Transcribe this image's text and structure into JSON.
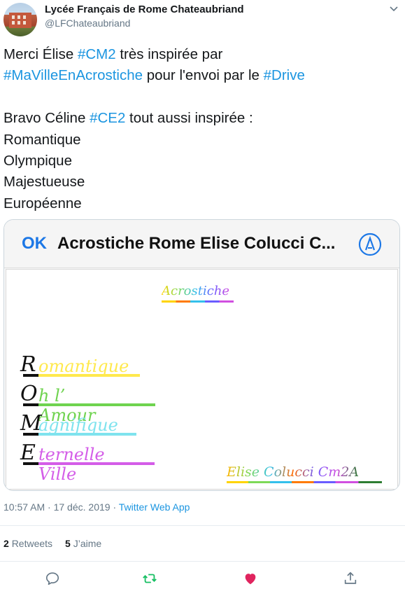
{
  "account": {
    "name": "Lycée Français de Rome Chateaubriand",
    "handle": "@LFChateaubriand"
  },
  "tweet": {
    "line1": [
      "Merci Élise ",
      "#CM2",
      " très inspirée par"
    ],
    "line2": [
      "#MaVilleEnAcrostiche",
      " pour l'envoi par le ",
      "#Drive"
    ],
    "line3": [
      "Bravo Céline ",
      "#CE2",
      " tout aussi inspirée :"
    ],
    "line4": "Romantique",
    "line5": "Olympique",
    "line6": "Majestueuse",
    "line7": "Européenne"
  },
  "card": {
    "ok_label": "OK",
    "title": "Acrostiche Rome Elise Colucci C...",
    "image": {
      "heading": "Acrostiche",
      "lines": [
        {
          "cap": "R",
          "rest": "omantique",
          "color": "#ffe94d"
        },
        {
          "cap": "O",
          "rest": "h l’ Amour",
          "color": "#6fd34f"
        },
        {
          "cap": "M",
          "rest": "agnifique",
          "color": "#7fe3ee"
        },
        {
          "cap": "E",
          "rest": "ternelle Ville",
          "color": "#d45de8"
        }
      ],
      "signature": "Elise Colucci Cm2A"
    }
  },
  "meta": {
    "time": "10:57 AM · 17 déc. 2019",
    "separator": " · ",
    "app": "Twitter Web App"
  },
  "stats": {
    "retweets_count": "2",
    "retweets_label": "Retweets",
    "likes_count": "5",
    "likes_label": "J’aime"
  },
  "colors": {
    "link": "#1b95e0",
    "retweet": "#17bf63",
    "like": "#e0245e",
    "muted": "#657786"
  },
  "icons": [
    "caret-down-icon",
    "pen-circle-icon",
    "reply-icon",
    "retweet-icon",
    "heart-icon",
    "share-icon"
  ]
}
